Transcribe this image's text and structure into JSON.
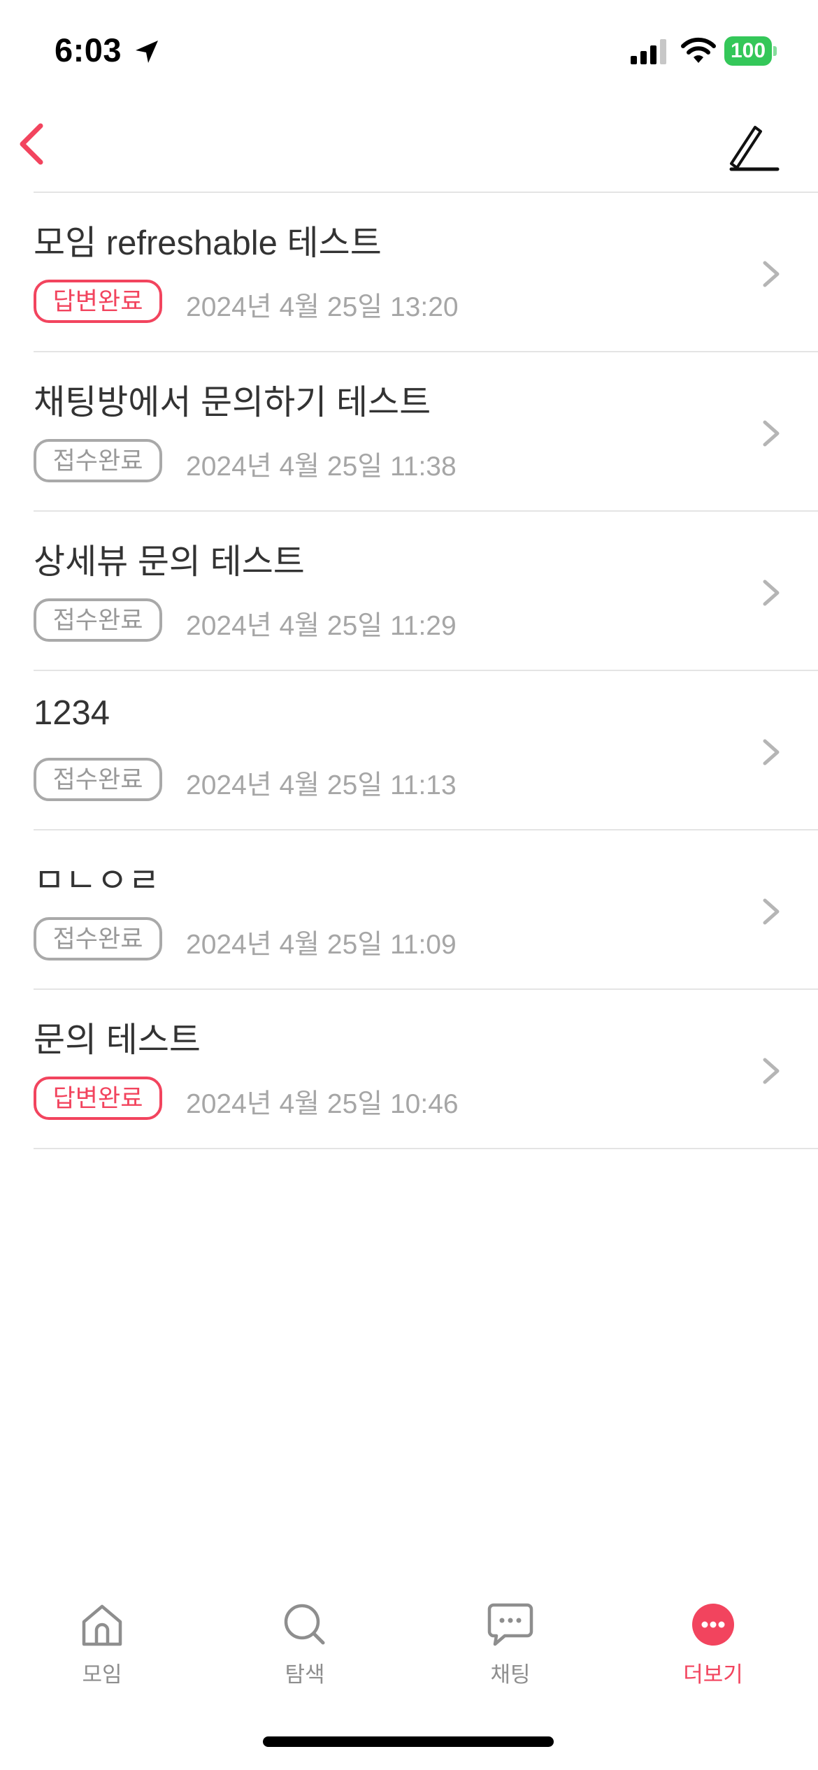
{
  "status_bar": {
    "time": "6:03",
    "battery": "100"
  },
  "inquiries": [
    {
      "title": "모임 refreshable 테스트",
      "status": "답변완료",
      "status_type": "answered",
      "date": "2024년 4월 25일 13:20"
    },
    {
      "title": "채팅방에서 문의하기 테스트",
      "status": "접수완료",
      "status_type": "received",
      "date": "2024년 4월 25일 11:38"
    },
    {
      "title": "상세뷰 문의 테스트",
      "status": "접수완료",
      "status_type": "received",
      "date": "2024년 4월 25일 11:29"
    },
    {
      "title": "1234",
      "status": "접수완료",
      "status_type": "received",
      "date": "2024년 4월 25일 11:13"
    },
    {
      "title": "ㅁㄴㅇㄹ",
      "status": "접수완료",
      "status_type": "received",
      "date": "2024년 4월 25일 11:09"
    },
    {
      "title": "문의 테스트",
      "status": "답변완료",
      "status_type": "answered",
      "date": "2024년 4월 25일 10:46"
    }
  ],
  "tabs": [
    {
      "label": "모임",
      "icon": "home-icon",
      "active": false
    },
    {
      "label": "탐색",
      "icon": "search-icon",
      "active": false
    },
    {
      "label": "채팅",
      "icon": "chat-bubble-icon",
      "active": false
    },
    {
      "label": "더보기",
      "icon": "more-icon",
      "active": true
    }
  ],
  "colors": {
    "accent": "#f2445e",
    "battery_green": "#34c759",
    "muted_badge": "#a9a9a9",
    "date_text": "#a6a6a6",
    "divider": "#e4e4e4"
  }
}
